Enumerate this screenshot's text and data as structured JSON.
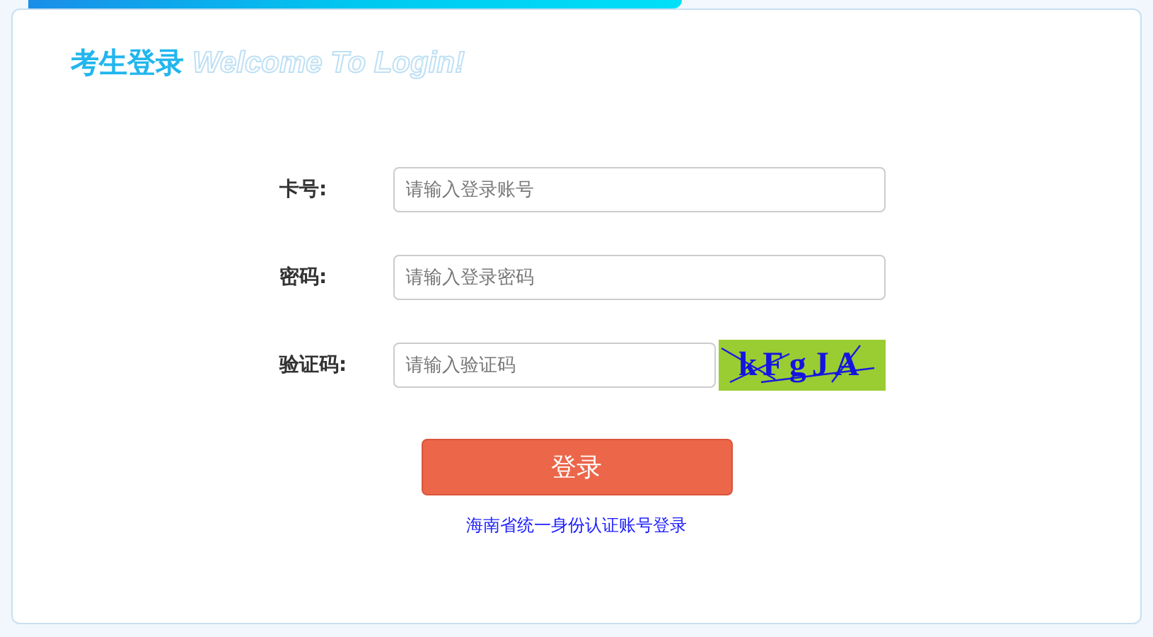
{
  "header": {
    "title": "考生登录",
    "subtitle": "Welcome To Login!"
  },
  "fields": [
    {
      "label": "卡号:",
      "placeholder": "请输入登录账号",
      "kind": "text"
    },
    {
      "label": "密码:",
      "placeholder": "请输入登录密码",
      "kind": "password"
    },
    {
      "label": "验证码:",
      "placeholder": "请输入验证码",
      "kind": "captcha",
      "captcha": "kFgJA"
    }
  ],
  "login_button": "登录",
  "alt_login_link": "海南省统一身份认证账号登录"
}
